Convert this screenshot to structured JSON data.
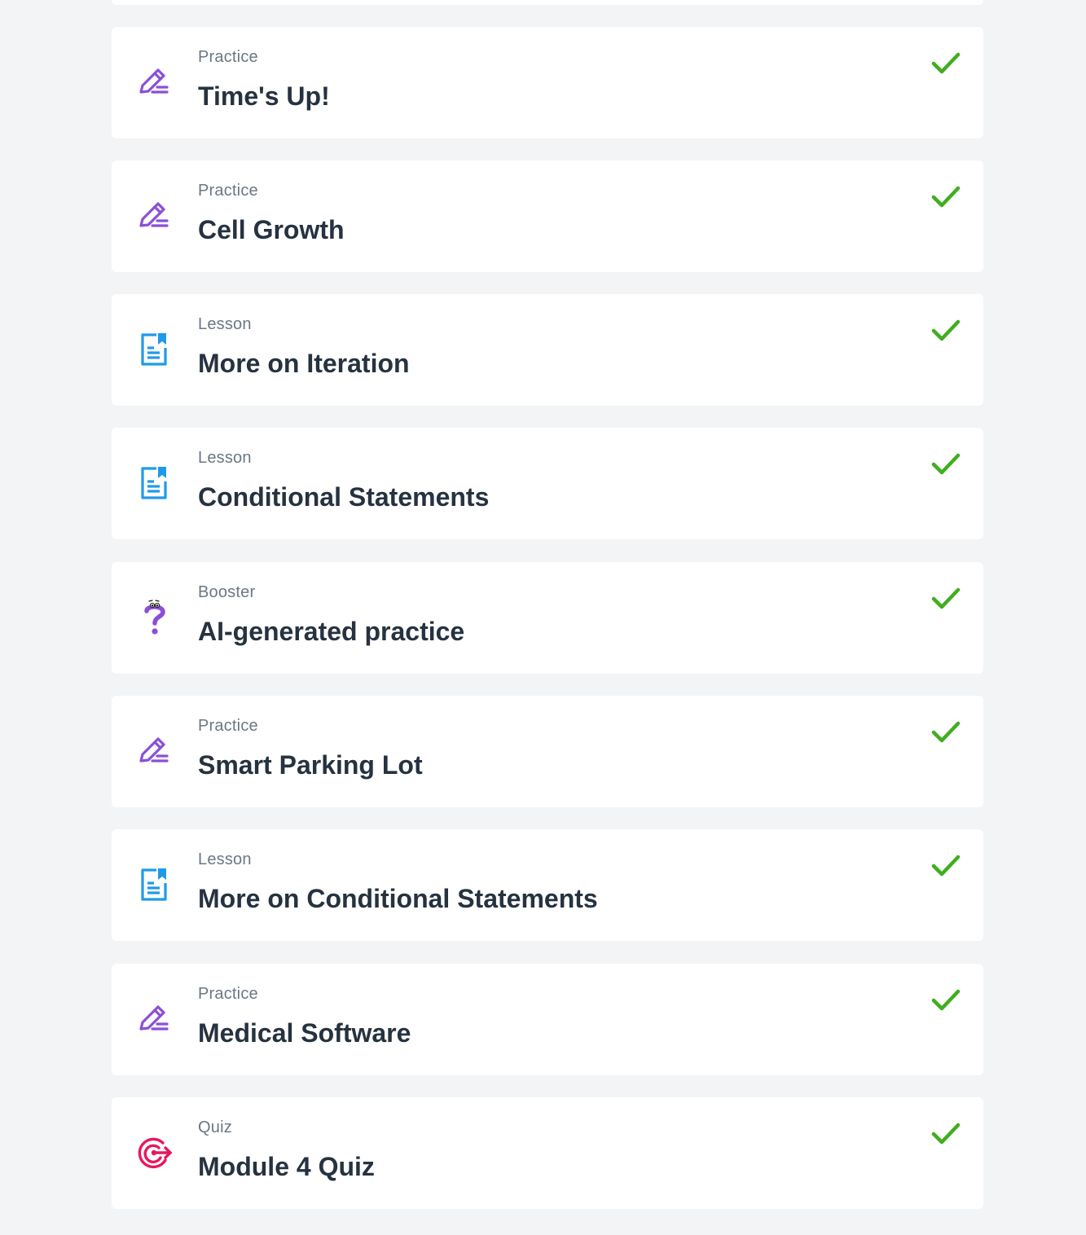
{
  "colors": {
    "background": "#f2f4f6",
    "card": "#ffffff",
    "type_text": "#6b7785",
    "title_text": "#263240",
    "practice_icon": "#8b4fd8",
    "lesson_icon": "#1f9ae8",
    "booster_icon": "#8b4fd8",
    "quiz_icon": "#e8175d",
    "check": "#3fae1f"
  },
  "items": [
    {
      "type": "Practice",
      "title": "Time's Up!",
      "icon": "pencil-icon",
      "completed": true
    },
    {
      "type": "Practice",
      "title": "Cell Growth",
      "icon": "pencil-icon",
      "completed": true
    },
    {
      "type": "Lesson",
      "title": "More on Iteration",
      "icon": "document-bookmark-icon",
      "completed": true
    },
    {
      "type": "Lesson",
      "title": "Conditional Statements",
      "icon": "document-bookmark-icon",
      "completed": true
    },
    {
      "type": "Booster",
      "title": "AI-generated practice",
      "icon": "question-mark-icon",
      "completed": true
    },
    {
      "type": "Practice",
      "title": "Smart Parking Lot",
      "icon": "pencil-icon",
      "completed": true
    },
    {
      "type": "Lesson",
      "title": "More on Conditional Statements",
      "icon": "document-bookmark-icon",
      "completed": true
    },
    {
      "type": "Practice",
      "title": "Medical Software",
      "icon": "pencil-icon",
      "completed": true
    },
    {
      "type": "Quiz",
      "title": "Module 4 Quiz",
      "icon": "target-icon",
      "completed": true
    }
  ]
}
